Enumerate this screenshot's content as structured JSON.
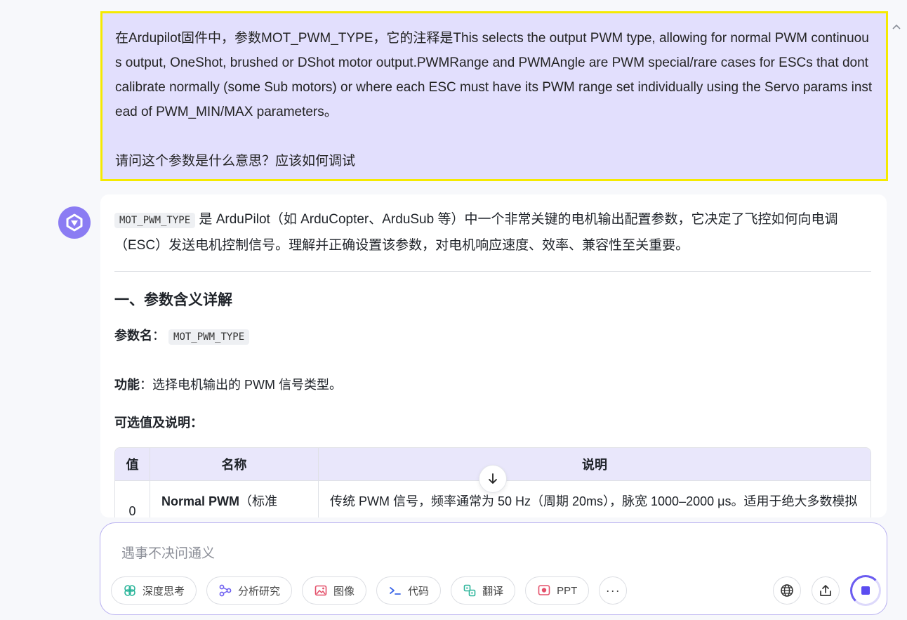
{
  "user_message": {
    "paragraph": "在Ardupilot固件中，参数MOT_PWM_TYPE，它的注释是This selects the output PWM type, allowing for normal PWM continuous output, OneShot, brushed or DShot motor output.PWMRange and PWMAngle are PWM special/rare cases for ESCs that dont calibrate normally (some Sub motors) or where each ESC must have its PWM range set individually using the Servo params instead of PWM_MIN/MAX parameters。",
    "question": "请问这个参数是什么意思？应该如何调试"
  },
  "answer": {
    "intro_code": "MOT_PWM_TYPE",
    "intro_text": " 是 ArduPilot（如 ArduCopter、ArduSub 等）中一个非常关键的电机输出配置参数，它决定了飞控如何向电调（ESC）发送电机控制信号。理解并正确设置该参数，对电机响应速度、效率、兼容性至关重要。",
    "section_title": "一、参数含义详解",
    "param_label": "参数名",
    "param_sep": "：",
    "param_code": "MOT_PWM_TYPE",
    "func_label": "功能",
    "func_text": "：选择电机输出的 PWM 信号类型。",
    "options_label": "可选值及说明：",
    "table": {
      "headers": [
        "值",
        "名称",
        "说明"
      ],
      "rows": [
        {
          "value": "0",
          "name_bold": "Normal PWM",
          "name_rest": "（标准",
          "desc": "传统 PWM 信号，频率通常为 50 Hz（周期 20ms），脉宽 1000–2000 μs。适用于绝大多数模拟"
        }
      ]
    }
  },
  "composer": {
    "placeholder": "遇事不决问通义",
    "tools": [
      "深度思考",
      "分析研究",
      "图像",
      "代码",
      "翻译",
      "PPT"
    ],
    "more": "···"
  },
  "icons": {
    "collapse": "chevron-up-icon",
    "scroll_down": "arrow-down-icon",
    "brand": "#8b7cf3"
  }
}
